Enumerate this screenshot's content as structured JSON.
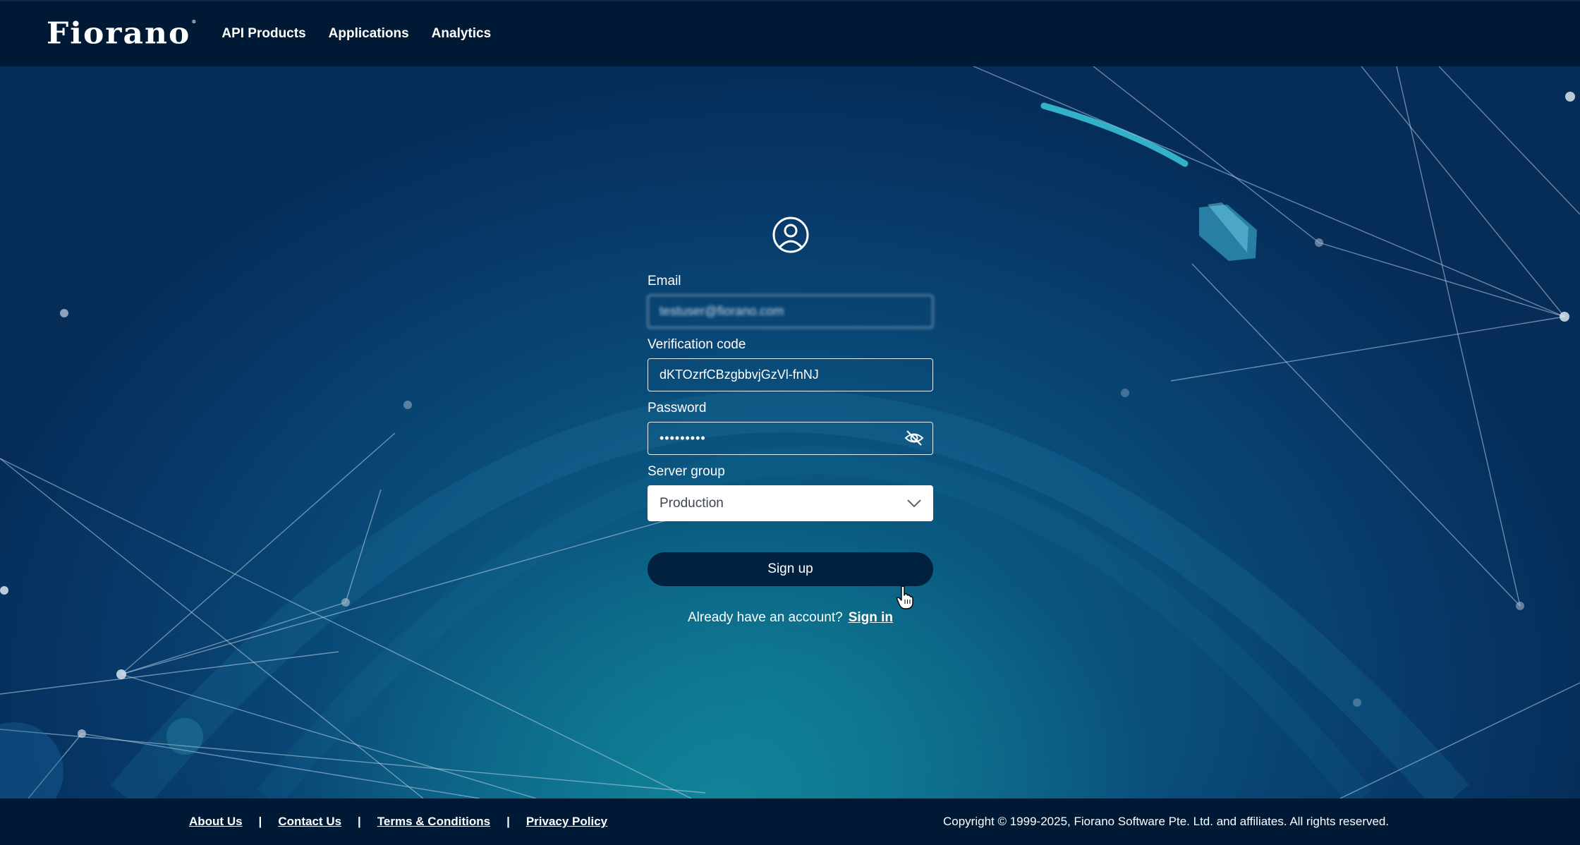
{
  "header": {
    "logo_text": "Fiorano",
    "logo_tm": "®",
    "nav": [
      "API Products",
      "Applications",
      "Analytics"
    ]
  },
  "form": {
    "email": {
      "label": "Email",
      "value": "testuser@fiorano.com"
    },
    "verification": {
      "label": "Verification code",
      "value": "dKTOzrfCBzgbbvjGzVl-fnNJ"
    },
    "password": {
      "label": "Password",
      "value": "•••••••••"
    },
    "server_group": {
      "label": "Server group",
      "value": "Production"
    },
    "signup_label": "Sign up",
    "already_text": "Already have an account?",
    "signin_label": "Sign in"
  },
  "footer": {
    "links": [
      "About Us",
      "Contact Us",
      "Terms & Conditions",
      "Privacy Policy"
    ],
    "separator": "|",
    "copyright": "Copyright © 1999-2025, Fiorano Software Pte. Ltd. and affiliates. All rights reserved."
  },
  "colors": {
    "header_bg": "#001a35",
    "button_bg": "#02203f",
    "hero_teal": "#0b6a88"
  },
  "icons": {
    "avatar": "user-circle-icon",
    "password_toggle": "eye-off-icon",
    "dropdown": "chevron-down-icon",
    "cursor": "hand-pointer-icon"
  }
}
